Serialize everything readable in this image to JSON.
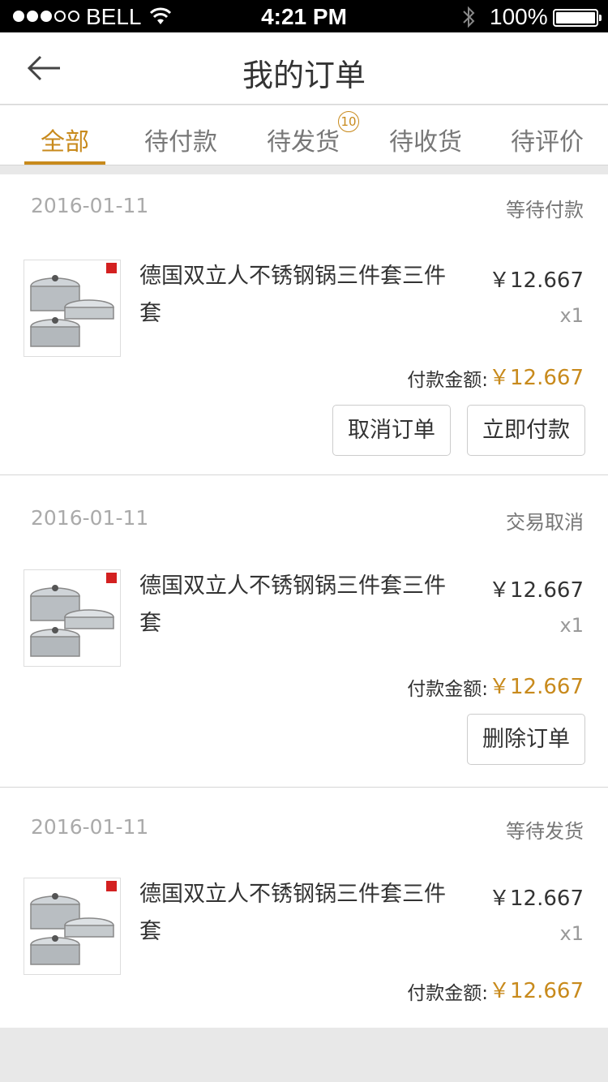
{
  "status_bar": {
    "carrier": "BELL",
    "time": "4:21 PM",
    "battery": "100%"
  },
  "header": {
    "title": "我的订单",
    "back_icon": "arrow-left-icon"
  },
  "tabs": [
    {
      "label": "全部",
      "active": true
    },
    {
      "label": "待付款"
    },
    {
      "label": "待发货",
      "badge": "10"
    },
    {
      "label": "待收货"
    },
    {
      "label": "待评价"
    }
  ],
  "accent_color": "#c88a1c",
  "orders": [
    {
      "date": "2016-01-11",
      "status": "等待付款",
      "product_name": "德国双立人不锈钢锅三件套三件套",
      "price": "￥12.667",
      "qty": "x1",
      "total_label": "付款金额:",
      "total_value": "￥12.667",
      "buttons": [
        "取消订单",
        "立即付款"
      ]
    },
    {
      "date": "2016-01-11",
      "status": "交易取消",
      "product_name": "德国双立人不锈钢锅三件套三件套",
      "price": "￥12.667",
      "qty": "x1",
      "total_label": "付款金额:",
      "total_value": "￥12.667",
      "buttons": [
        "删除订单"
      ]
    },
    {
      "date": "2016-01-11",
      "status": "等待发货",
      "product_name": "德国双立人不锈钢锅三件套三件套",
      "price": "￥12.667",
      "qty": "x1",
      "total_label": "付款金额:",
      "total_value": "￥12.667",
      "buttons": []
    }
  ]
}
